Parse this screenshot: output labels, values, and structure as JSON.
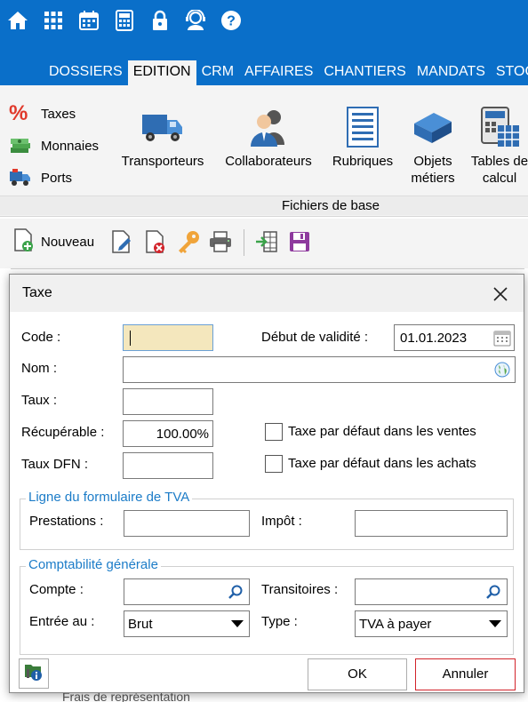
{
  "topbar": {
    "icons": [
      "home-icon",
      "apps-grid-icon",
      "calendar-icon",
      "calculator-icon",
      "lock-icon",
      "user-support-icon",
      "help-icon"
    ],
    "tabs": [
      "DOSSIERS",
      "EDITION",
      "CRM",
      "AFFAIRES",
      "CHANTIERS",
      "MANDATS",
      "STOCK"
    ],
    "active_tab": "EDITION",
    "color": "#0a6fc9"
  },
  "ribbon": {
    "small_items": [
      "Taxes",
      "Monnaies",
      "Ports"
    ],
    "big_buttons": [
      {
        "label": "Transporteurs",
        "icon": "truck-icon"
      },
      {
        "label": "Collaborateurs",
        "icon": "people-icon"
      },
      {
        "label": "Rubriques",
        "icon": "list-document-icon"
      },
      {
        "label": "Objets métiers",
        "icon": "cube-icon"
      },
      {
        "label": "Tables de calcul",
        "icon": "calc-table-icon"
      }
    ],
    "group_label": "Fichiers de base"
  },
  "toolbar": {
    "new_label": "Nouveau"
  },
  "background": {
    "row_text": "Frais de représentation"
  },
  "dialog": {
    "title": "Taxe",
    "code_label": "Code :",
    "code_value": "",
    "validity_label": "Début de validité :",
    "validity_value": "01.01.2023",
    "name_label": "Nom :",
    "name_value": "",
    "rate_label": "Taux :",
    "rate_value": "",
    "recoverable_label": "Récupérable :",
    "recoverable_value": "100.00%",
    "dfn_label": "Taux DFN :",
    "dfn_value": "",
    "default_sales_label": "Taxe par défaut dans les ventes",
    "default_sales_checked": false,
    "default_purchases_label": "Taxe par défaut dans les achats",
    "default_purchases_checked": false,
    "vat_group_title": "Ligne du formulaire de TVA",
    "services_label": "Prestations :",
    "services_value": "",
    "tax_label": "Impôt :",
    "tax_value": "",
    "accounting_group_title": "Comptabilité générale",
    "account_label": "Compte :",
    "account_value": "",
    "transitory_label": "Transitoires :",
    "transitory_value": "",
    "entry_label": "Entrée au :",
    "entry_value": "Brut",
    "type_label": "Type :",
    "type_value": "TVA à payer",
    "ok_label": "OK",
    "cancel_label": "Annuler",
    "accent_color": "#1c7cc8",
    "cancel_border_color": "#d2232a"
  }
}
